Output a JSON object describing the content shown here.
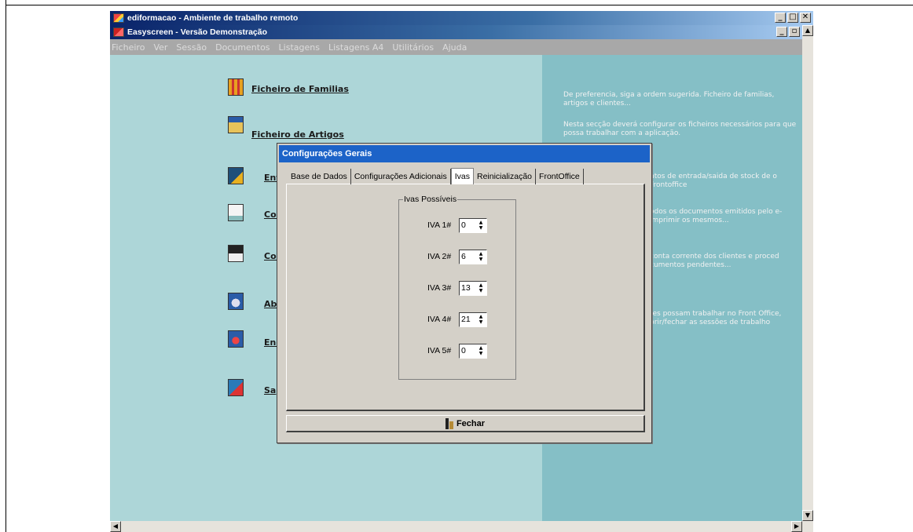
{
  "outer_title": "ediformacao - Ambiente de trabalho remoto",
  "inner_title": "Easyscreen - Versão Demonstração",
  "menubar": [
    "Ficheiro",
    "Ver",
    "Sessão",
    "Documentos",
    "Listagens",
    "Listagens A4",
    "Utilitários",
    "Ajuda"
  ],
  "main_menu": [
    {
      "label": "Ficheiro de Familias",
      "icon": "grid-icon"
    },
    {
      "label": "Ficheiro de Artigos",
      "icon": "box-icon"
    },
    {
      "label": "Ent",
      "icon": "stock-icon"
    },
    {
      "label": "Cor",
      "icon": "document-icon"
    },
    {
      "label": "Cor",
      "icon": "ledger-icon"
    },
    {
      "label": "Abr",
      "icon": "open-session-icon"
    },
    {
      "label": "Enc",
      "icon": "close-session-icon"
    },
    {
      "label": "Sa",
      "icon": "exit-icon"
    }
  ],
  "descriptions": [
    "De preferencia, siga a ordem sugerida. Ficheiro de familias, artigos e clientes...",
    "Nesta secção deverá configurar os ficheiros necessários para que possa trabalhar com a aplicação.",
    "ntos de entrada/saida de stock de o Frontoffice",
    "odos os documentos emitidos pelo e-imprimir os mesmos...",
    "conta corrente dos clientes e proced cumentos pendentes...",
    "res possam trabalhar no Front Office, brir/fechar as sessões de trabalho"
  ],
  "dialog": {
    "title": "Configurações Gerais",
    "tabs": [
      "Base de Dados",
      "Configurações Adicionais",
      "Ivas",
      "Reinicialização",
      "FrontOffice"
    ],
    "active_tab": "Ivas",
    "group_label": "Ivas Possíveis",
    "ivas": [
      {
        "label": "IVA 1#",
        "value": "0"
      },
      {
        "label": "IVA 2#",
        "value": "6"
      },
      {
        "label": "IVA 3#",
        "value": "13"
      },
      {
        "label": "IVA 4#",
        "value": "21"
      },
      {
        "label": "IVA 5#",
        "value": "0"
      }
    ],
    "close_label": "Fechar"
  },
  "colors": {
    "left_panel": "#add6d8",
    "right_panel": "#85bfc6",
    "dialog_title": "#1c63c8"
  }
}
